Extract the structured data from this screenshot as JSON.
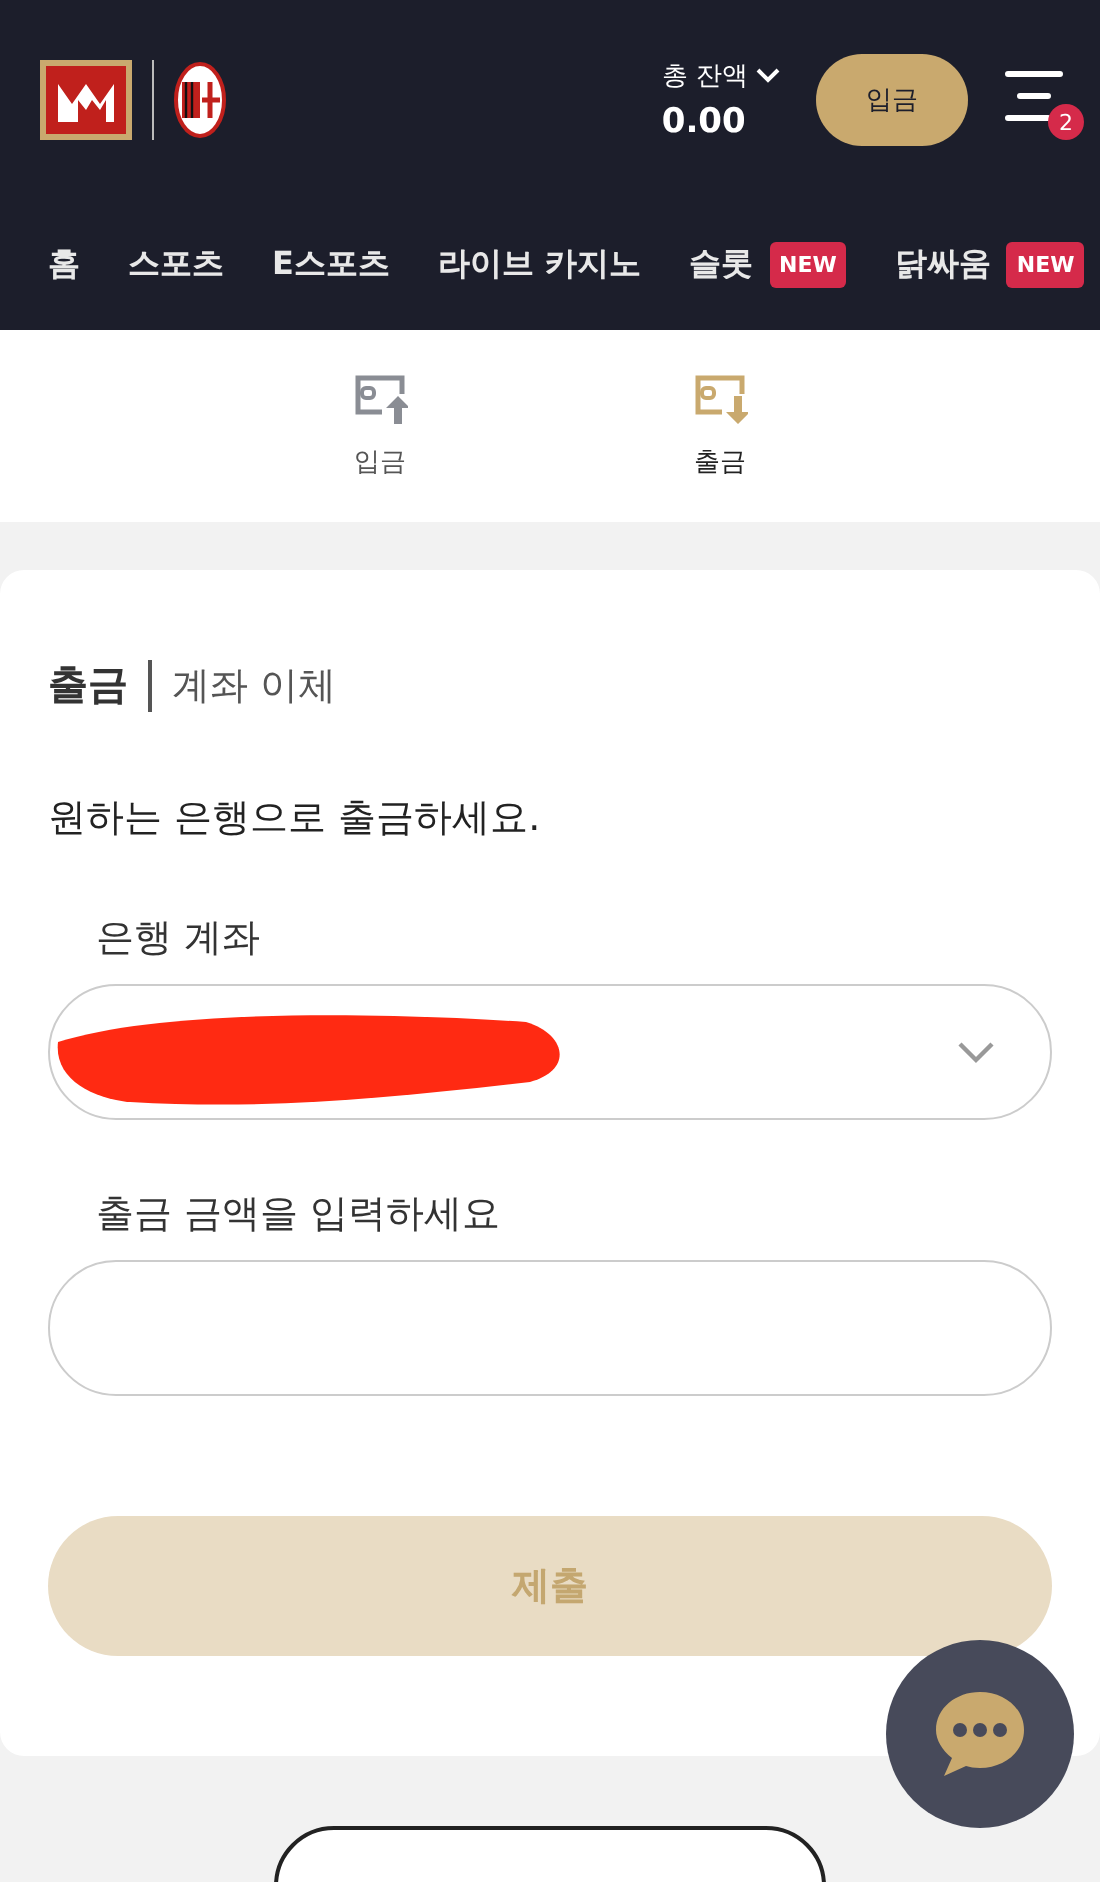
{
  "header": {
    "balance_label": "총 잔액",
    "balance": "0.00",
    "deposit_button": "입금",
    "menu_badge": "2"
  },
  "nav": [
    {
      "label": "홈"
    },
    {
      "label": "스포츠"
    },
    {
      "label": "E스포츠"
    },
    {
      "label": "라이브 카지노"
    },
    {
      "label": "슬롯",
      "badge": "NEW"
    },
    {
      "label": "닭싸움",
      "badge": "NEW"
    }
  ],
  "tabs": [
    {
      "label": "입금",
      "kind": "deposit",
      "selected": false
    },
    {
      "label": "출금",
      "kind": "withdraw",
      "selected": true
    }
  ],
  "card": {
    "title": "출금",
    "subtitle": "계좌 이체",
    "instruction": "원하는 은행으로 출금하세요.",
    "fields": [
      {
        "label": "은행 계좌",
        "kind": "select",
        "redacted": true
      },
      {
        "label": "출금 금액을 입력하세요",
        "kind": "text"
      }
    ],
    "submit": {
      "label": "제출",
      "disabled": true
    }
  }
}
